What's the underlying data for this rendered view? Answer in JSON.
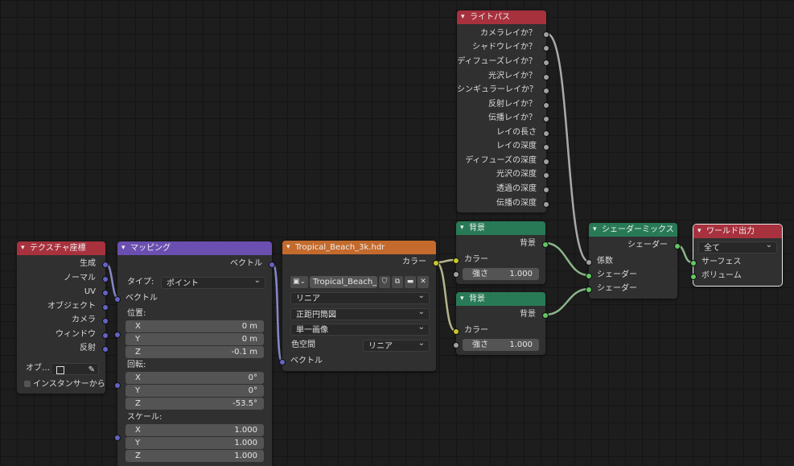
{
  "nodes": {
    "texcoord": {
      "title": "テクスチャ座標",
      "outputs": [
        "生成",
        "ノーマル",
        "UV",
        "オブジェクト",
        "カメラ",
        "ウィンドウ",
        "反射"
      ],
      "object_label": "オブ…",
      "instancer_label": "インスタンサーから"
    },
    "mapping": {
      "title": "マッピング",
      "output": "ベクトル",
      "type_label": "タイプ:",
      "type_value": "ポイント",
      "vector_input": "ベクトル",
      "location_label": "位置:",
      "location": [
        {
          "axis": "X",
          "value": "0 m"
        },
        {
          "axis": "Y",
          "value": "0 m"
        },
        {
          "axis": "Z",
          "value": "-0.1 m"
        }
      ],
      "rotation_label": "回転:",
      "rotation": [
        {
          "axis": "X",
          "value": "0°"
        },
        {
          "axis": "Y",
          "value": "0°"
        },
        {
          "axis": "Z",
          "value": "-53.5°"
        }
      ],
      "scale_label": "スケール:",
      "scale": [
        {
          "axis": "X",
          "value": "1.000"
        },
        {
          "axis": "Y",
          "value": "1.000"
        },
        {
          "axis": "Z",
          "value": "1.000"
        }
      ]
    },
    "envtex": {
      "title": "Tropical_Beach_3k.hdr",
      "output": "カラー",
      "image_name": "Tropical_Beach_3…",
      "interpolation": "リニア",
      "projection": "正距円筒図",
      "source": "単一画像",
      "colorspace_label": "色空間",
      "colorspace_value": "リニア",
      "vector_input": "ベクトル"
    },
    "lightpath": {
      "title": "ライトパス",
      "outputs": [
        "カメラレイか？",
        "シャドウレイか？",
        "ディフューズレイか？",
        "光沢レイか？",
        "シンギュラーレイか？",
        "反射レイか？",
        "伝播レイか？",
        "レイの長さ",
        "レイの深度",
        "ディフューズの深度",
        "光沢の深度",
        "透過の深度",
        "伝播の深度"
      ]
    },
    "bg1": {
      "title": "背景",
      "output": "背景",
      "color_label": "カラー",
      "strength_label": "強さ",
      "strength_value": "1.000"
    },
    "bg2": {
      "title": "背景",
      "output": "背景",
      "color_label": "カラー",
      "strength_label": "強さ",
      "strength_value": "1.000"
    },
    "mix": {
      "title": "シェーダーミックス",
      "output": "シェーダー",
      "inputs": [
        "係数",
        "シェーダー",
        "シェーダー"
      ]
    },
    "worldout": {
      "title": "ワールド出力",
      "target": "全て",
      "inputs": [
        "サーフェス",
        "ボリューム"
      ]
    }
  },
  "colors": {
    "header_red": "#a8313e",
    "header_purple": "#6a4fb0",
    "header_orange": "#c36a2c",
    "header_green": "#287a56",
    "socket_vector": "#6363c7",
    "socket_float": "#a1a1a1",
    "socket_color": "#c7c729",
    "socket_shader": "#63c763"
  }
}
